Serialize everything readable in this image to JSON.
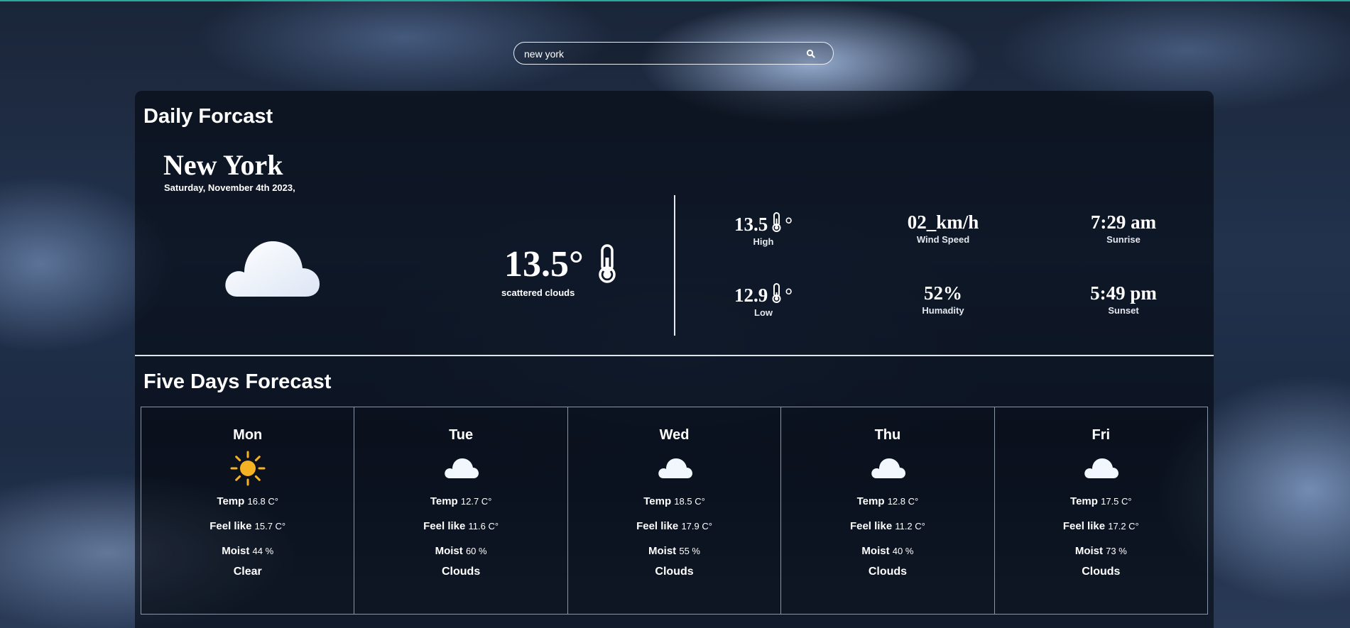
{
  "search": {
    "value": "new york",
    "placeholder": ""
  },
  "daily": {
    "heading": "Daily Forcast",
    "city": "New York",
    "date": "Saturday, November 4th 2023,",
    "current_temp": "13.5°",
    "description": "scattered clouds",
    "high": {
      "value": "13.5",
      "label": "High"
    },
    "low": {
      "value": "12.9",
      "label": "Low"
    },
    "wind": {
      "value": "02_km/h",
      "label": "Wind Speed"
    },
    "humidity": {
      "value": "52%",
      "label": "Humadity"
    },
    "sunrise": {
      "value": "7:29 am",
      "label": "Sunrise"
    },
    "sunset": {
      "value": "5:49 pm",
      "label": "Sunset"
    },
    "degree": "°"
  },
  "five_days": {
    "heading": "Five Days Forecast",
    "labels": {
      "temp": "Temp",
      "feel": "Feel like",
      "moist": "Moist"
    },
    "days": [
      {
        "day": "Mon",
        "icon": "sun-icon",
        "temp": "16.8 C°",
        "feel": "15.7 C°",
        "moist": "44 %",
        "condition": "Clear"
      },
      {
        "day": "Tue",
        "icon": "cloud-icon",
        "temp": "12.7 C°",
        "feel": "11.6 C°",
        "moist": "60 %",
        "condition": "Clouds"
      },
      {
        "day": "Wed",
        "icon": "cloud-icon",
        "temp": "18.5 C°",
        "feel": "17.9 C°",
        "moist": "55 %",
        "condition": "Clouds"
      },
      {
        "day": "Thu",
        "icon": "cloud-icon",
        "temp": "12.8 C°",
        "feel": "11.2 C°",
        "moist": "40 %",
        "condition": "Clouds"
      },
      {
        "day": "Fri",
        "icon": "cloud-icon",
        "temp": "17.5 C°",
        "feel": "17.2 C°",
        "moist": "73 %",
        "condition": "Clouds"
      }
    ]
  },
  "colors": {
    "accent_line": "#2aa79b",
    "sun": "#f5b324",
    "cloud": "#f2f6fd"
  }
}
